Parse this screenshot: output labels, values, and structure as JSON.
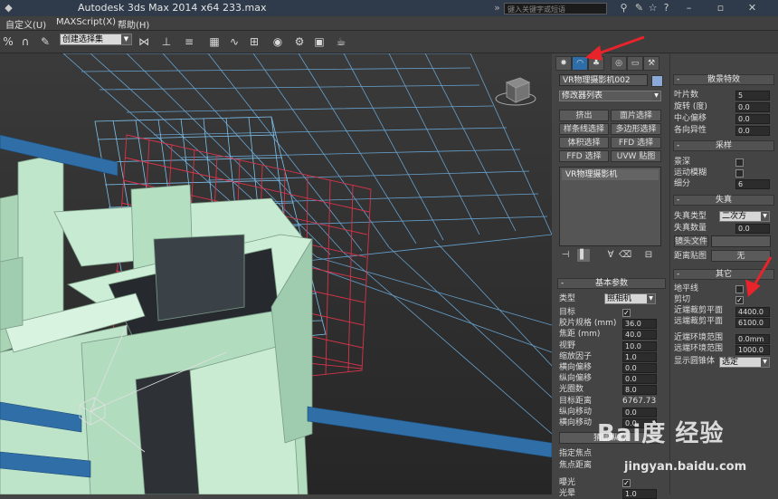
{
  "titlebar": {
    "app": "Autodesk 3ds Max  2014 x64",
    "file": "233.max",
    "search_placeholder": "键入关键字或短语"
  },
  "menubar": {
    "items": [
      "自定义(U)",
      "MAXScript(X)",
      "帮助(H)"
    ]
  },
  "toolbar": {
    "selection_set": "创建选择集"
  },
  "cmd_tabs": [
    "create",
    "modify",
    "hierarchy",
    "motion",
    "display",
    "utilities"
  ],
  "modify_panel": {
    "object_name": "VR物理摄影机002",
    "modifier_list": "修改器列表",
    "buttons": [
      "挤出",
      "面片选择",
      "样条线选择",
      "多边形选择",
      "体积选择",
      "FFD 选择",
      "FFD 选择",
      "UVW 贴图"
    ],
    "stack_item": "VR物理摄影机"
  },
  "basic_params": {
    "title": "基本参数",
    "type_label": "类型",
    "type_value": "照相机",
    "rows": [
      {
        "label": "目标",
        "value": "✓",
        "kind": "check"
      },
      {
        "label": "胶片规格 (mm)",
        "value": "36.0",
        "kind": "spin"
      },
      {
        "label": "焦距 (mm)",
        "value": "40.0",
        "kind": "spin"
      },
      {
        "label": "视野",
        "value": "10.0",
        "kind": "spin"
      },
      {
        "label": "缩放因子",
        "value": "1.0",
        "kind": "spin"
      },
      {
        "label": "横向偏移",
        "value": "0.0",
        "kind": "spin"
      },
      {
        "label": "纵向偏移",
        "value": "0.0",
        "kind": "spin"
      },
      {
        "label": "光圈数",
        "value": "8.0",
        "kind": "spin"
      },
      {
        "label": "目标距离",
        "value": "6767.73",
        "kind": "text"
      },
      {
        "label": "纵向移动",
        "value": "0.0",
        "kind": "spin"
      },
      {
        "label": "横向移动",
        "value": "0.0",
        "kind": "spin"
      }
    ],
    "guess_button": "猜测纵向",
    "focus_label": "指定焦点",
    "focus_dist_label": "焦点距离",
    "exposure_label": "曝光",
    "vignette_label": "光晕",
    "vignette_value": "1.0"
  },
  "bokeh": {
    "title": "散景特效",
    "rows": [
      {
        "label": "叶片数",
        "value": "5"
      },
      {
        "label": "旋转 (度)",
        "value": "0.0"
      },
      {
        "label": "中心偏移",
        "value": "0.0"
      },
      {
        "label": "各向异性",
        "value": "0.0"
      }
    ]
  },
  "sampling": {
    "title": "采样",
    "rows": [
      {
        "label": "景深"
      },
      {
        "label": "运动模糊"
      },
      {
        "label": "细分",
        "value": "6"
      }
    ]
  },
  "distortion": {
    "title": "失真",
    "type_label": "失真类型",
    "type_value": "二次方",
    "amount_label": "失真数量",
    "amount_value": "0.0",
    "lens_file_button": "镜头文件",
    "map_button": "距离贴图",
    "none_button": "无"
  },
  "misc": {
    "title": "其它",
    "horizon_label": "地平线",
    "clip_label": "剪切",
    "clip_checked": "✓",
    "near_clip_label": "近端裁剪平面",
    "near_clip_value": "4400.0",
    "far_clip_label": "远端裁剪平面",
    "far_clip_value": "6100.0",
    "near_env_label": "近端环境范围",
    "near_env_value": "0.0mm",
    "far_env_label": "远端环境范围",
    "far_env_value": "1000.0",
    "display_cone_label": "显示圆锥体",
    "display_cone_value": "选定"
  },
  "watermark": {
    "logo": "Bai度 经验",
    "url": "jingyan.baidu.com"
  },
  "colors": {
    "annotation_arrow": "#e8242a",
    "active_tab": "#2e6ea8",
    "wall": "#b8e0c4",
    "beam": "#2f6ea6",
    "grid_blue": "#6fb4e8",
    "grid_red": "#d8334a"
  }
}
